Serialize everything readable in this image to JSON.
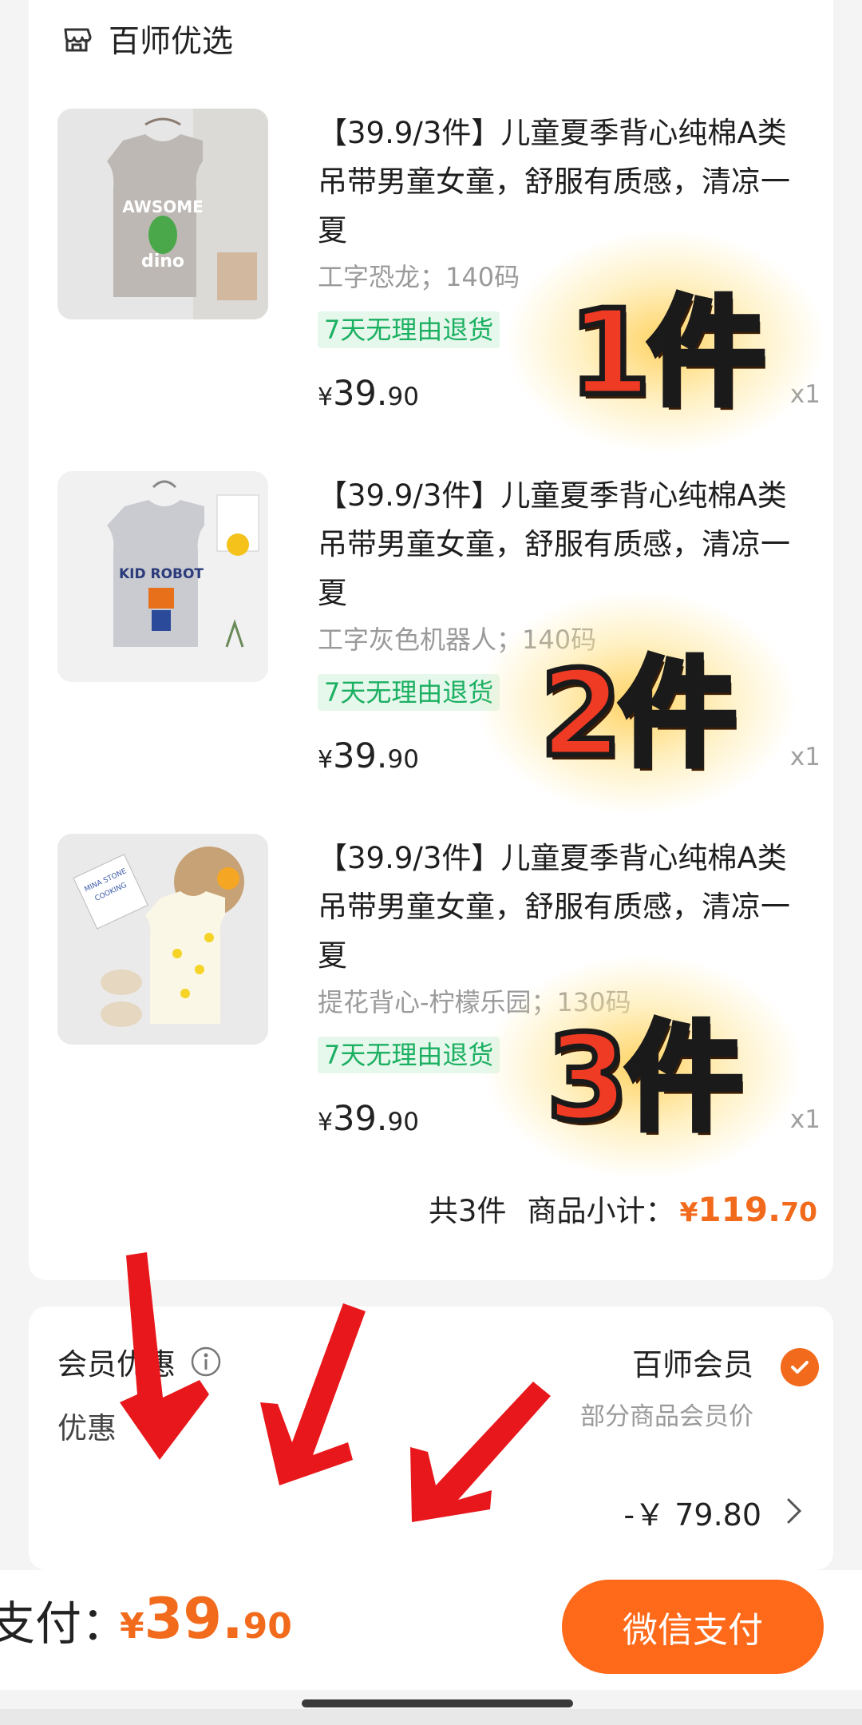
{
  "store": {
    "name": "百师优选",
    "icon": "store-icon"
  },
  "items": [
    {
      "title": "【39.9/3件】儿童夏季背心纯棉A类吊带男童女童，舒服有质感，清凉一夏",
      "spec": "工字恐龙；140码",
      "tag": "7天无理由退货",
      "currency": "¥",
      "price_int": "39.",
      "price_dec": "90",
      "qty": "x1",
      "sticker": "1件"
    },
    {
      "title": "【39.9/3件】儿童夏季背心纯棉A类吊带男童女童，舒服有质感，清凉一夏",
      "spec": "工字灰色机器人；140码",
      "tag": "7天无理由退货",
      "currency": "¥",
      "price_int": "39.",
      "price_dec": "90",
      "qty": "x1",
      "sticker": "2件"
    },
    {
      "title": "【39.9/3件】儿童夏季背心纯棉A类吊带男童女童，舒服有质感，清凉一夏",
      "spec": "提花背心-柠檬乐园；130码",
      "tag": "7天无理由退货",
      "currency": "¥",
      "price_int": "39.",
      "price_dec": "90",
      "qty": "x1",
      "sticker": "3件"
    }
  ],
  "summary": {
    "count": "共3件",
    "subtotal_label": "商品小计：",
    "currency": "¥",
    "int": "119.",
    "dec": "70"
  },
  "member": {
    "label": "会员优惠",
    "title": "百师会员",
    "desc": "部分商品会员价",
    "sub_label": "优惠",
    "discount": "-￥ 79.80"
  },
  "bottom": {
    "pay_label": "支付：",
    "currency": "¥",
    "int": "39.",
    "dec": "90",
    "button": "微信支付"
  },
  "colors": {
    "accent": "#ff6a1a",
    "tag_green": "#1bb061",
    "annotation_red": "#e8171b"
  }
}
